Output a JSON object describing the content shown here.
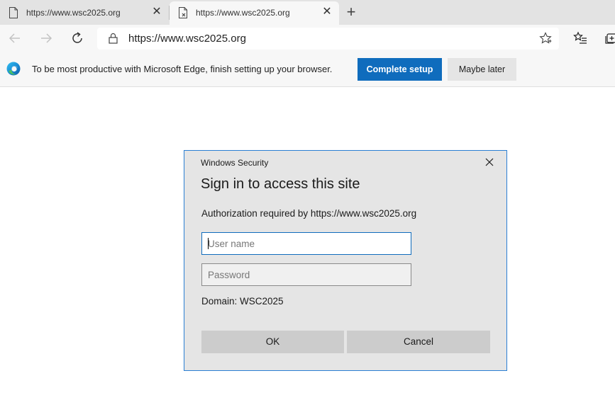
{
  "tabs": [
    {
      "title": "https://www.wsc2025.org",
      "active": false
    },
    {
      "title": "https://www.wsc2025.org",
      "active": true
    }
  ],
  "address_bar": {
    "url": "https://www.wsc2025.org"
  },
  "infobar": {
    "message": "To be most productive with Microsoft Edge, finish setting up your browser.",
    "primary_label": "Complete setup",
    "secondary_label": "Maybe later"
  },
  "dialog": {
    "caption": "Windows Security",
    "title": "Sign in to access this site",
    "auth_message": "Authorization required by https://www.wsc2025.org",
    "username": {
      "value": "",
      "placeholder": "User name"
    },
    "password": {
      "value": "",
      "placeholder": "Password"
    },
    "domain": "Domain: WSC2025",
    "ok_label": "OK",
    "cancel_label": "Cancel"
  },
  "icons": {
    "tab_favicon": "page-icon",
    "tab_close": "close-icon",
    "new_tab": "plus-icon",
    "back": "arrow-left-icon",
    "forward": "arrow-right-icon",
    "refresh": "refresh-icon",
    "lock": "lock-icon",
    "favorite": "star-icon",
    "favorites": "favorites-list-icon",
    "collections": "collections-icon",
    "edge": "edge-logo-icon"
  },
  "colors": {
    "accent": "#0f6cbd",
    "dialog_border": "#2a7fd4",
    "dialog_bg": "#e5e5e5"
  }
}
